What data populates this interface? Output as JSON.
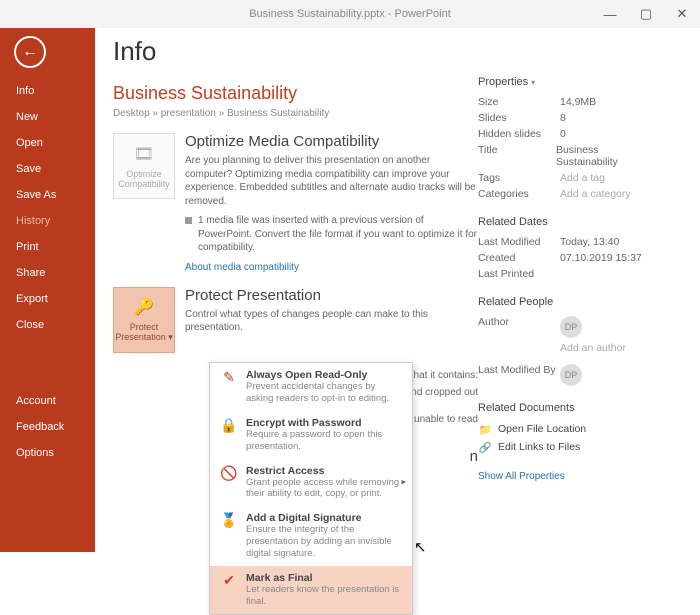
{
  "window": {
    "title": "Business Sustainability.pptx - PowerPoint"
  },
  "sidebar": {
    "items": [
      "Info",
      "New",
      "Open",
      "Save",
      "Save As",
      "History",
      "Print",
      "Share",
      "Export",
      "Close"
    ],
    "bottom": [
      "Account",
      "Feedback",
      "Options"
    ]
  },
  "page": {
    "heading": "Info",
    "filename": "Business Sustainability",
    "breadcrumb": "Desktop » presentation » Business Sustainability"
  },
  "optimize": {
    "btn": "Optimize Compatibility",
    "title": "Optimize Media Compatibility",
    "desc": "Are you planning to deliver this presentation on another computer? Optimizing media compatibility can improve your experience. Embedded subtitles and alternate audio tracks will be removed.",
    "bullet": "1 media file was inserted with a previous version of PowerPoint. Convert the file format if you want to optimize it for compatibility.",
    "link": "About media compatibility"
  },
  "protect": {
    "btn": "Protect Presentation",
    "title": "Protect Presentation",
    "desc": "Control what types of changes people can make to this presentation."
  },
  "dropdown": [
    {
      "title": "Always Open Read-Only",
      "desc": "Prevent accidental changes by asking readers to opt-in to editing.",
      "icon": "✎"
    },
    {
      "title": "Encrypt with Password",
      "desc": "Require a password to open this presentation.",
      "icon": "🔒"
    },
    {
      "title": "Restrict Access",
      "desc": "Grant people access while removing their ability to edit, copy, or print.",
      "icon": "🚫",
      "arrow": true
    },
    {
      "title": "Add a Digital Signature",
      "desc": "Ensure the integrity of the presentation by adding an invisible digital signature.",
      "icon": "🏅"
    },
    {
      "title": "Mark as Final",
      "desc": "Let readers know the presentation is final.",
      "icon": "✔",
      "hl": true
    }
  ],
  "hidden_text": {
    "a": "ware that it contains:",
    "b": "or's name and cropped out",
    "c": "isabilities are unable to read",
    "d": "n"
  },
  "props": {
    "heading": "Properties",
    "rows": [
      {
        "label": "Size",
        "value": "14,9MB"
      },
      {
        "label": "Slides",
        "value": "8"
      },
      {
        "label": "Hidden slides",
        "value": "0"
      },
      {
        "label": "Title",
        "value": "Business Sustainability"
      },
      {
        "label": "Tags",
        "value": "Add a tag",
        "ph": true
      },
      {
        "label": "Categories",
        "value": "Add a category",
        "ph": true
      }
    ],
    "dates_heading": "Related Dates",
    "dates": [
      {
        "label": "Last Modified",
        "value": "Today, 13:40"
      },
      {
        "label": "Created",
        "value": "07.10.2019 15:37"
      },
      {
        "label": "Last Printed",
        "value": ""
      }
    ],
    "people_heading": "Related People",
    "author_label": "Author",
    "author_initials": "DP",
    "add_author": "Add an author",
    "modifiedby_label": "Last Modified By",
    "modifiedby_initials": "DP",
    "docs_heading": "Related Documents",
    "open_loc": "Open File Location",
    "edit_links": "Edit Links to Files",
    "show_all": "Show All Properties"
  }
}
